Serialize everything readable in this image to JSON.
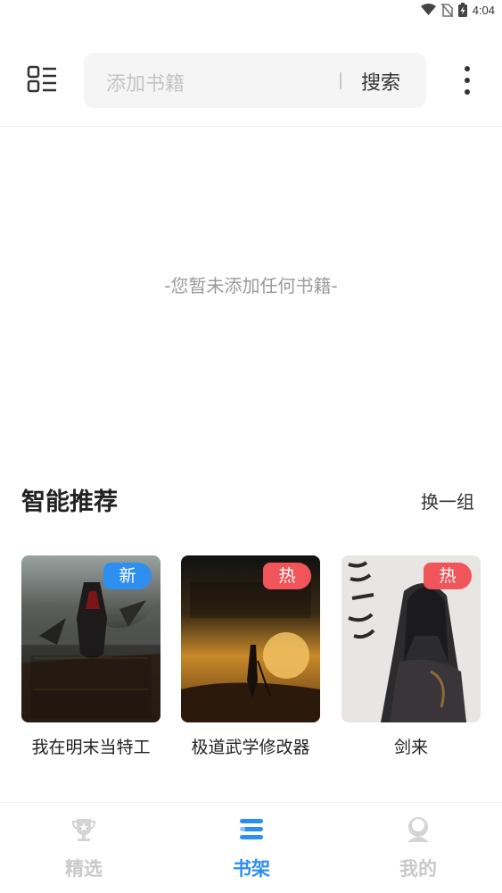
{
  "status_bar": {
    "time": "4:04",
    "icons": [
      "wifi-icon",
      "no-sim-icon",
      "battery-charging-icon"
    ]
  },
  "header": {
    "menu_icon": "grid-list-icon",
    "search_placeholder": "添加书籍",
    "search_button": "搜索",
    "more_icon": "more-vertical-icon"
  },
  "bookshelf": {
    "empty_message": "-您暂未添加任何书籍-"
  },
  "recommend": {
    "title": "智能推荐",
    "refresh_label": "换一组",
    "books": [
      {
        "title": "我在明末当特工",
        "badge": "新",
        "badge_color": "#2f8ff0"
      },
      {
        "title": "极道武学修改器",
        "badge": "热",
        "badge_color": "#f0555a"
      },
      {
        "title": "剑来",
        "badge": "热",
        "badge_color": "#f0555a"
      }
    ]
  },
  "tabs": [
    {
      "label": "精选",
      "icon": "trophy-icon",
      "active": false
    },
    {
      "label": "书架",
      "icon": "bookshelf-icon",
      "active": true
    },
    {
      "label": "我的",
      "icon": "user-icon",
      "active": false
    }
  ],
  "colors": {
    "accent": "#2b8ef2",
    "inactive": "#c9c9c9",
    "new_badge": "#2f8ff0",
    "hot_badge": "#f0555a"
  }
}
